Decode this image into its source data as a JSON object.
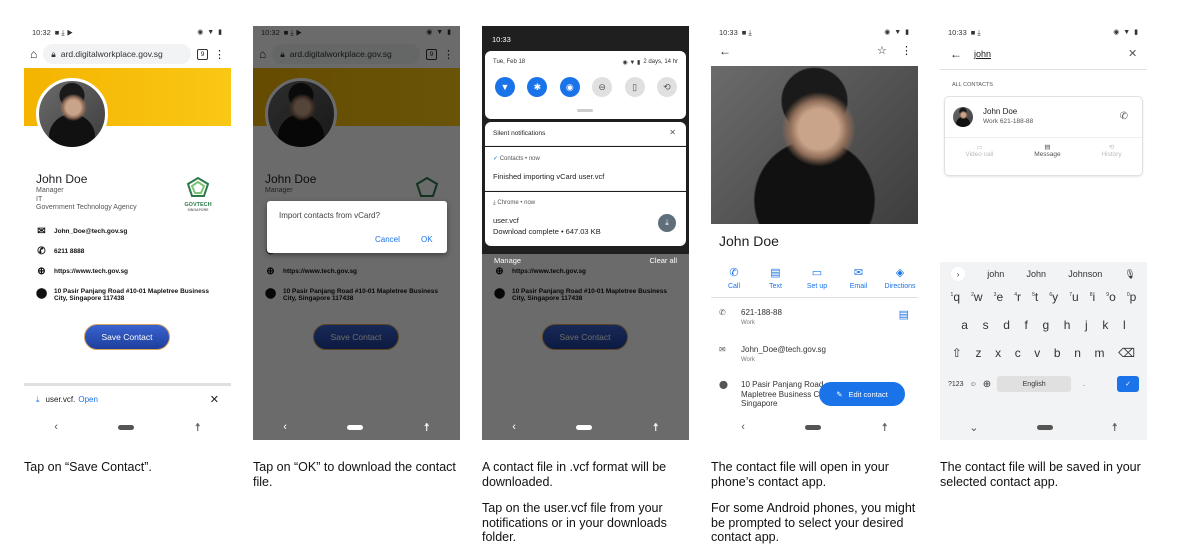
{
  "colors": {
    "accent": "#1a73e8",
    "header_yellow": "#f4b400",
    "save_button": "#2748b0",
    "govtech_green": "#2b7a4b"
  },
  "captions": [
    {
      "paragraphs": [
        "Tap on “Save Contact”."
      ]
    },
    {
      "paragraphs": [
        "Tap on “OK” to download the contact file."
      ]
    },
    {
      "paragraphs": [
        "A contact file in .vcf format will be downloaded.",
        "Tap on the user.vcf file from your notifications or in your downloads folder."
      ]
    },
    {
      "paragraphs": [
        "The contact file will open in your phone’s contact app.",
        "For some Android phones, you might be prompted to select your desired contact app."
      ]
    },
    {
      "paragraphs": [
        "The contact file will be saved in your selected contact app."
      ]
    }
  ],
  "browser": {
    "time": "10:32",
    "url": "ard.digitalworkplace.gov.sg",
    "tab_count": "9",
    "menu_icon": "more-vert-icon"
  },
  "profile": {
    "name": "John Doe",
    "title": "Manager",
    "department": "IT",
    "agency": "Government Technology Agency",
    "logo_text": "GOVTECH",
    "logo_subtext": "SINGAPORE",
    "email": "John_Doe@tech.gov.sg",
    "phone": "6211 8888",
    "website": "https://www.tech.gov.sg",
    "address": "10 Pasir Panjang Road #10-01 Mapletree Business City, Singapore 117438",
    "save_label": "Save Contact"
  },
  "download_bar": {
    "file": "user.vcf.",
    "open": "Open"
  },
  "dialog": {
    "message": "Import contacts from vCard?",
    "cancel": "Cancel",
    "ok": "OK"
  },
  "shade": {
    "time": "10:33",
    "date": "Tue, Feb 18",
    "battery": "2 days, 14 hr",
    "tiles": [
      "wifi-icon",
      "bluetooth-icon",
      "location-icon",
      "dnd-icon",
      "flashlight-icon",
      "rotate-icon"
    ],
    "section": "Silent notifications",
    "notif1_app": "Contacts • now",
    "notif1_text": "Finished importing vCard user.vcf",
    "notif2_app": "Chrome • now",
    "notif2_title": "user.vcf",
    "notif2_text": "Download complete • 647.03 KB",
    "manage": "Manage",
    "clear_all": "Clear all"
  },
  "contact_app": {
    "time": "10:33",
    "name": "John Doe",
    "actions": [
      {
        "label": "Call",
        "icon": "phone-icon"
      },
      {
        "label": "Text",
        "icon": "message-icon"
      },
      {
        "label": "Set up",
        "icon": "video-icon"
      },
      {
        "label": "Email",
        "icon": "email-icon"
      },
      {
        "label": "Directions",
        "icon": "directions-icon"
      }
    ],
    "phone": "621-188-88",
    "phone_type": "Work",
    "email": "John_Doe@tech.gov.sg",
    "email_type": "Work",
    "address": "10 Pasir Panjang Road Mapletree Business City Singapore",
    "edit": "Edit contact"
  },
  "search_app": {
    "time": "10:33",
    "query": "john",
    "section": "ALL CONTACTS",
    "result_name": "John Doe",
    "result_sub": "Work 621-188-88",
    "actions": [
      "Video call",
      "Message",
      "History"
    ],
    "suggestions": [
      "john",
      "John",
      "Johnson"
    ],
    "row1": [
      "q",
      "w",
      "e",
      "r",
      "t",
      "y",
      "u",
      "i",
      "o",
      "p"
    ],
    "row1_hints": [
      "1",
      "2",
      "3",
      "4",
      "5",
      "6",
      "7",
      "8",
      "9",
      "0"
    ],
    "row2": [
      "a",
      "s",
      "d",
      "f",
      "g",
      "h",
      "j",
      "k",
      "l"
    ],
    "row3": [
      "z",
      "x",
      "c",
      "v",
      "b",
      "n",
      "m"
    ],
    "symbols": "?123",
    "space": "English",
    "period": "."
  }
}
